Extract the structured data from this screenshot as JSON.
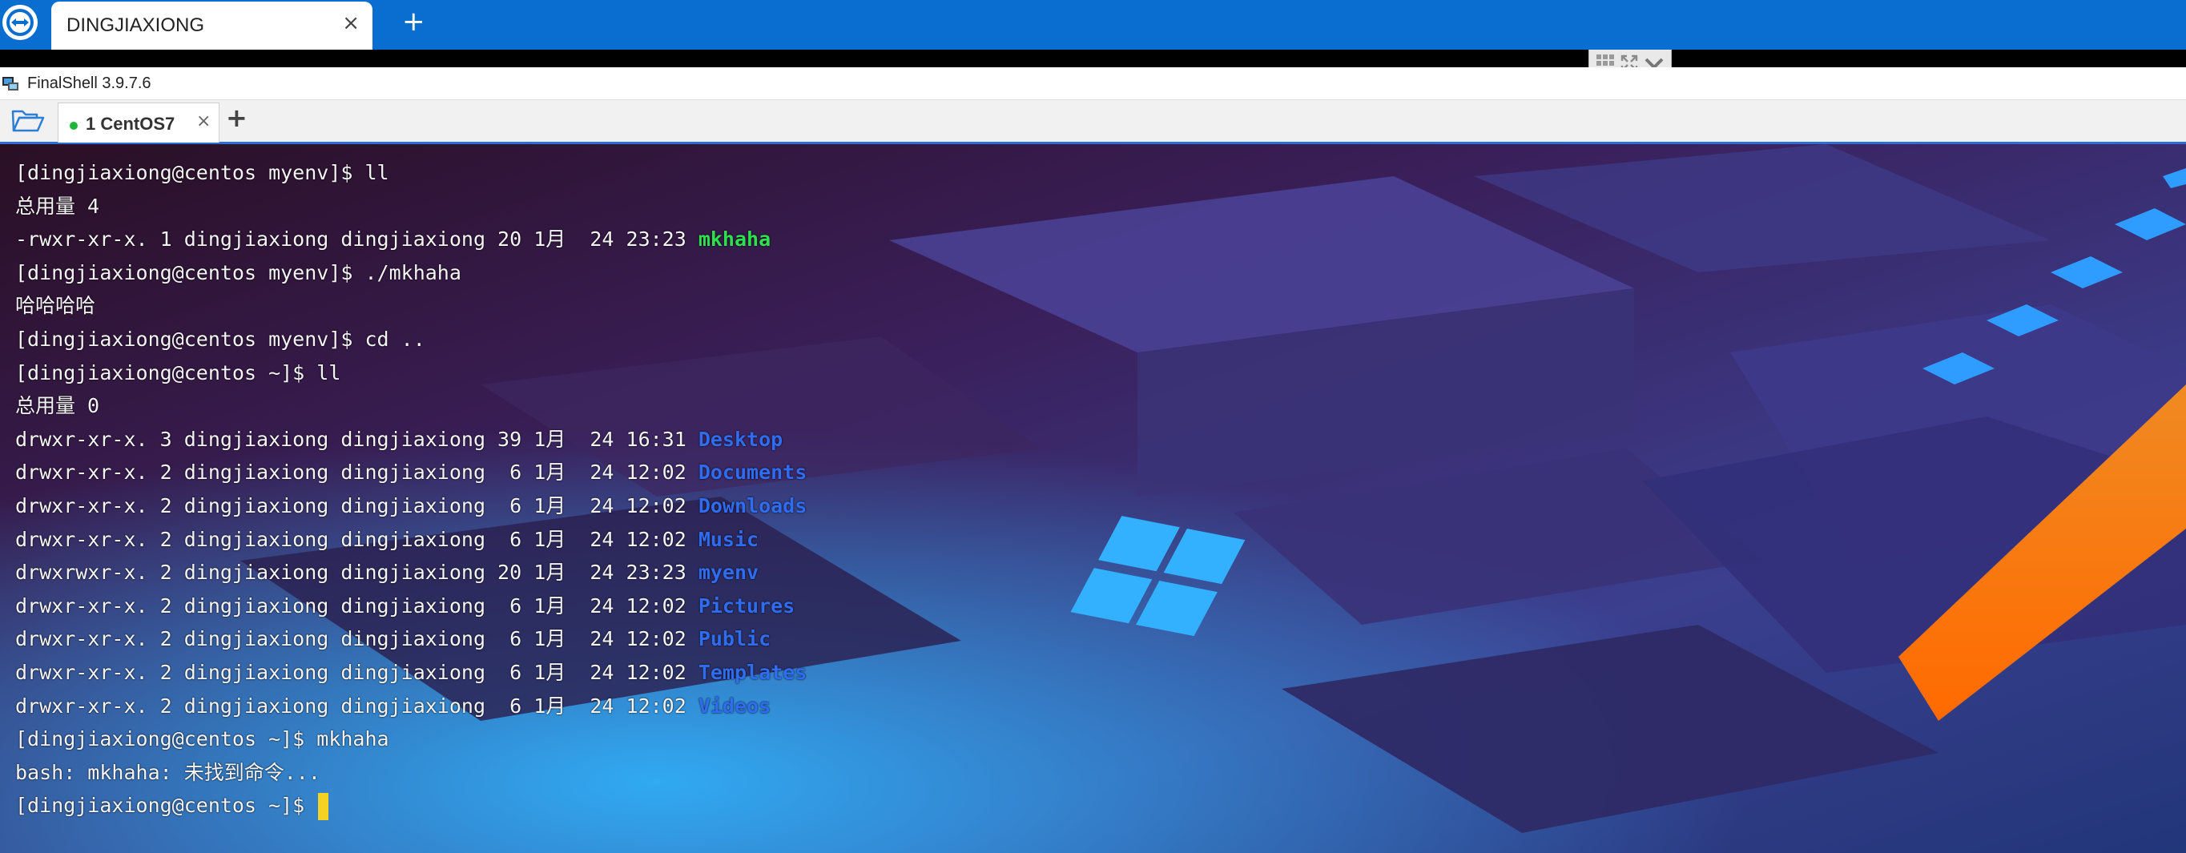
{
  "remote_session": {
    "tab_title": "DINGJIAXIONG",
    "close_symbol": "×",
    "new_tab_symbol": "+",
    "logo_icon": "teamviewer-logo-icon",
    "brand_color": "#0a6ed1"
  },
  "finalshell": {
    "window_title": "FinalShell 3.9.7.6",
    "tabs": [
      {
        "label": "1 CentOS7",
        "status": "connected",
        "status_color": "#1fb53a",
        "close_symbol": "×"
      }
    ],
    "add_tab_symbol": "+",
    "folder_icon": "open-folder-icon"
  },
  "terminal": {
    "lines": [
      {
        "parts": [
          {
            "text": "[dingjiaxiong@centos myenv]$ ll",
            "style": "normal"
          }
        ]
      },
      {
        "parts": [
          {
            "text": "总用量 4",
            "style": "normal"
          }
        ]
      },
      {
        "parts": [
          {
            "text": "-rwxr-xr-x. 1 dingjiaxiong dingjiaxiong 20 1月  24 23:23 ",
            "style": "normal"
          },
          {
            "text": "mkhaha",
            "style": "exec"
          }
        ]
      },
      {
        "parts": [
          {
            "text": "[dingjiaxiong@centos myenv]$ ./mkhaha",
            "style": "normal"
          }
        ]
      },
      {
        "parts": [
          {
            "text": "哈哈哈哈",
            "style": "normal"
          }
        ]
      },
      {
        "parts": [
          {
            "text": "[dingjiaxiong@centos myenv]$ cd ..",
            "style": "normal"
          }
        ]
      },
      {
        "parts": [
          {
            "text": "[dingjiaxiong@centos ~]$ ll",
            "style": "normal"
          }
        ]
      },
      {
        "parts": [
          {
            "text": "总用量 0",
            "style": "normal"
          }
        ]
      },
      {
        "parts": [
          {
            "text": "drwxr-xr-x. 3 dingjiaxiong dingjiaxiong 39 1月  24 16:31 ",
            "style": "normal"
          },
          {
            "text": "Desktop",
            "style": "dir"
          }
        ]
      },
      {
        "parts": [
          {
            "text": "drwxr-xr-x. 2 dingjiaxiong dingjiaxiong  6 1月  24 12:02 ",
            "style": "normal"
          },
          {
            "text": "Documents",
            "style": "dir"
          }
        ]
      },
      {
        "parts": [
          {
            "text": "drwxr-xr-x. 2 dingjiaxiong dingjiaxiong  6 1月  24 12:02 ",
            "style": "normal"
          },
          {
            "text": "Downloads",
            "style": "dir"
          }
        ]
      },
      {
        "parts": [
          {
            "text": "drwxr-xr-x. 2 dingjiaxiong dingjiaxiong  6 1月  24 12:02 ",
            "style": "normal"
          },
          {
            "text": "Music",
            "style": "dir"
          }
        ]
      },
      {
        "parts": [
          {
            "text": "drwxrwxr-x. 2 dingjiaxiong dingjiaxiong 20 1月  24 23:23 ",
            "style": "normal"
          },
          {
            "text": "myenv",
            "style": "dir"
          }
        ]
      },
      {
        "parts": [
          {
            "text": "drwxr-xr-x. 2 dingjiaxiong dingjiaxiong  6 1月  24 12:02 ",
            "style": "normal"
          },
          {
            "text": "Pictures",
            "style": "dir"
          }
        ]
      },
      {
        "parts": [
          {
            "text": "drwxr-xr-x. 2 dingjiaxiong dingjiaxiong  6 1月  24 12:02 ",
            "style": "normal"
          },
          {
            "text": "Public",
            "style": "dir"
          }
        ]
      },
      {
        "parts": [
          {
            "text": "drwxr-xr-x. 2 dingjiaxiong dingjiaxiong  6 1月  24 12:02 ",
            "style": "normal"
          },
          {
            "text": "Templates",
            "style": "dir"
          }
        ]
      },
      {
        "parts": [
          {
            "text": "drwxr-xr-x. 2 dingjiaxiong dingjiaxiong  6 1月  24 12:02 ",
            "style": "normal"
          },
          {
            "text": "Videos",
            "style": "dir"
          }
        ]
      },
      {
        "parts": [
          {
            "text": "[dingjiaxiong@centos ~]$ mkhaha",
            "style": "normal"
          }
        ]
      },
      {
        "parts": [
          {
            "text": "bash: mkhaha: 未找到命令...",
            "style": "normal"
          }
        ]
      },
      {
        "parts": [
          {
            "text": "[dingjiaxiong@centos ~]$ ",
            "style": "normal"
          }
        ],
        "cursor": true
      }
    ],
    "colors": {
      "text": "#f4f4f4",
      "executable": "#2ee04d",
      "directory": "#2f6cf0",
      "cursor": "#f3d224"
    }
  }
}
